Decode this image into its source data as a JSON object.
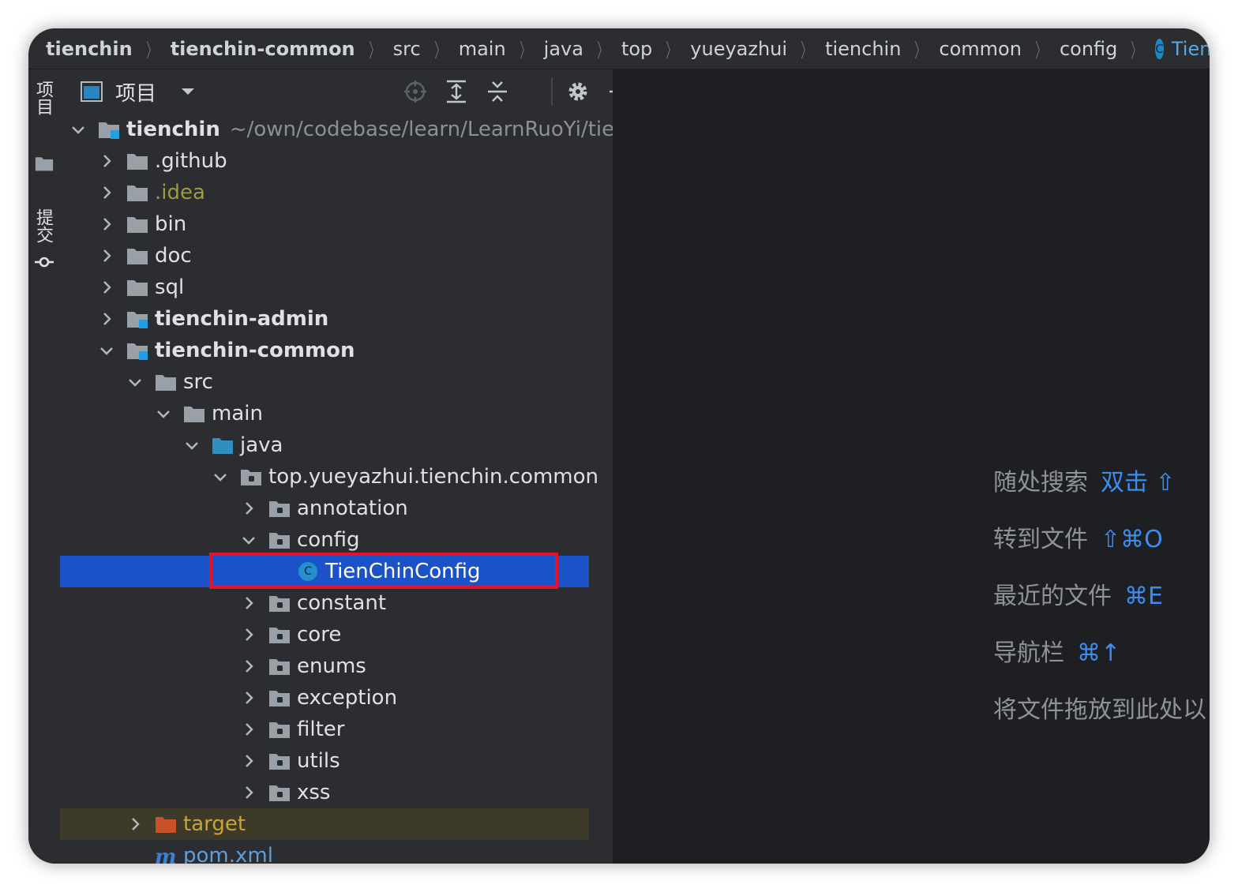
{
  "breadcrumb": [
    "tienchin",
    "tienchin-common",
    "src",
    "main",
    "java",
    "top",
    "yueyazhui",
    "tienchin",
    "common",
    "config",
    "TienChinConfig"
  ],
  "class_icon_letter": "C",
  "left_stripe": {
    "project_tab": "项目",
    "commit_tab": "提交"
  },
  "panel": {
    "title": "项目"
  },
  "tree": {
    "root_name": "tienchin",
    "root_path": "~/own/codebase/learn/LearnRuoYi/tier",
    "items": [
      {
        "label": ".github"
      },
      {
        "label": ".idea"
      },
      {
        "label": "bin"
      },
      {
        "label": "doc"
      },
      {
        "label": "sql"
      },
      {
        "label": "tienchin-admin"
      },
      {
        "label": "tienchin-common"
      },
      {
        "label": "src"
      },
      {
        "label": "main"
      },
      {
        "label": "java"
      },
      {
        "label": "top.yueyazhui.tienchin.common"
      },
      {
        "label": "annotation"
      },
      {
        "label": "config"
      },
      {
        "label": "TienChinConfig"
      },
      {
        "label": "constant"
      },
      {
        "label": "core"
      },
      {
        "label": "enums"
      },
      {
        "label": "exception"
      },
      {
        "label": "filter"
      },
      {
        "label": "utils"
      },
      {
        "label": "xss"
      },
      {
        "label": "target"
      },
      {
        "label": "pom.xml"
      }
    ]
  },
  "editor_hints": [
    {
      "text": "随处搜索",
      "key": "双击 ⇧"
    },
    {
      "text": "转到文件",
      "key": "⇧⌘O"
    },
    {
      "text": "最近的文件",
      "key": "⌘E"
    },
    {
      "text": "导航栏",
      "key": "⌘↑"
    },
    {
      "text": "将文件拖放到此处以",
      "key": ""
    }
  ],
  "colors": {
    "selection": "#1c52c7",
    "highlight_box": "#e8102a",
    "shortcut": "#3a8ef2"
  }
}
